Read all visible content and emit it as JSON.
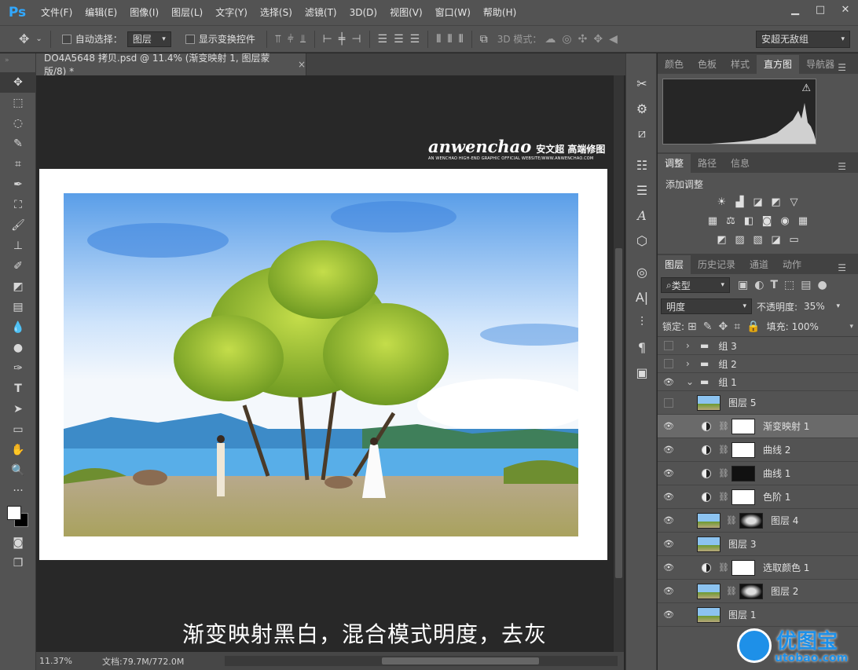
{
  "app": {
    "logo": "Ps"
  },
  "menu": [
    "文件(F)",
    "编辑(E)",
    "图像(I)",
    "图层(L)",
    "文字(Y)",
    "选择(S)",
    "滤镜(T)",
    "3D(D)",
    "视图(V)",
    "窗口(W)",
    "帮助(H)"
  ],
  "window_controls": {
    "minimize": "▁",
    "maximize": "□",
    "close": "✕"
  },
  "options": {
    "auto_select_label": "自动选择：",
    "auto_select_value": "图层",
    "show_transform_label": "显示变换控件",
    "mode3d_label": "3D 模式：",
    "workspace": "安超无敌组"
  },
  "document": {
    "tab_title": "DO4A5648 拷贝.psd @ 11.4% (渐变映射 1, 图层蒙版/8) *",
    "tab_close": "×",
    "zoom": "11.37%",
    "doc_size": "文档:79.7M/772.0M"
  },
  "brand": {
    "script": "anwenchao",
    "cn": "安文超 高端修图",
    "sub": "AN WENCHAO HIGH-END GRAPHIC OFFICIAL WEBSITE/WWW.ANWENCHAO.COM"
  },
  "caption": "渐变映射黑白，混合模式明度，去灰",
  "panel_top_tabs": [
    "颜色",
    "色板",
    "样式",
    "直方图",
    "导航器"
  ],
  "panel_top_active": "直方图",
  "panel_mid_tabs": [
    "调整",
    "路径",
    "信息"
  ],
  "adjust_title": "添加调整",
  "panel_layers_tabs": [
    "图层",
    "历史记录",
    "通道",
    "动作"
  ],
  "layers_filter": "类型",
  "blend_mode": "明度",
  "opacity_label": "不透明度:",
  "opacity_value": "35%",
  "lock_label": "锁定:",
  "fill_label": "填充:",
  "fill_value": "100%",
  "layers": [
    {
      "name": "组 3",
      "visible": false,
      "type": "group"
    },
    {
      "name": "组 2",
      "visible": false,
      "type": "group"
    },
    {
      "name": "组 1",
      "visible": true,
      "type": "group-open"
    },
    {
      "name": "图层 5",
      "visible": false,
      "type": "image"
    },
    {
      "name": "渐变映射 1",
      "visible": true,
      "type": "adjust",
      "selected": true
    },
    {
      "name": "曲线 2",
      "visible": true,
      "type": "adjust"
    },
    {
      "name": "曲线 1",
      "visible": true,
      "type": "adjust"
    },
    {
      "name": "色阶 1",
      "visible": true,
      "type": "adjust"
    },
    {
      "name": "图层 4",
      "visible": true,
      "type": "image-mask"
    },
    {
      "name": "图层 3",
      "visible": true,
      "type": "image"
    },
    {
      "name": "选取颜色 1",
      "visible": true,
      "type": "adjust"
    },
    {
      "name": "图层 2",
      "visible": true,
      "type": "image-mask"
    },
    {
      "name": "图层 1",
      "visible": true,
      "type": "image"
    }
  ],
  "watermark": {
    "cn": "优图宝",
    "url": "utobao.com"
  },
  "colors": {
    "accent": "#31a8ff",
    "panel": "#535353",
    "dark": "#282828"
  }
}
